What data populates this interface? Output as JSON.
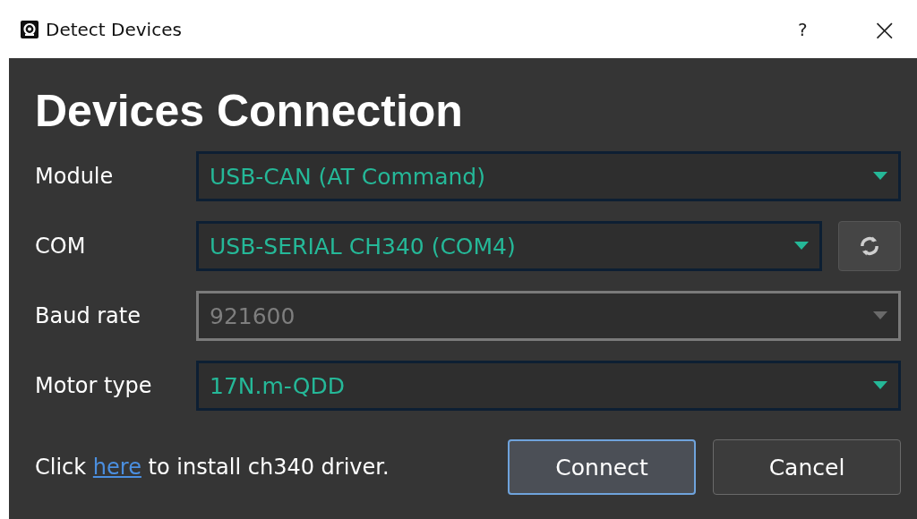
{
  "window": {
    "title": "Detect Devices",
    "help": "?",
    "close": "×"
  },
  "heading": "Devices Connection",
  "fields": [
    {
      "label": "Module",
      "value": "USB-CAN (AT Command)",
      "disabled": false,
      "refresh": false
    },
    {
      "label": "COM",
      "value": "USB-SERIAL CH340 (COM4)",
      "disabled": false,
      "refresh": true
    },
    {
      "label": "Baud rate",
      "value": "921600",
      "disabled": true,
      "refresh": false
    },
    {
      "label": "Motor type",
      "value": "17N.m-QDD",
      "disabled": false,
      "refresh": false
    }
  ],
  "driver_note": {
    "before": "Click",
    "link": "here",
    "after": "to install ch340 driver."
  },
  "buttons": [
    {
      "label": "Connect",
      "default": true
    },
    {
      "label": "Cancel",
      "default": false
    }
  ]
}
